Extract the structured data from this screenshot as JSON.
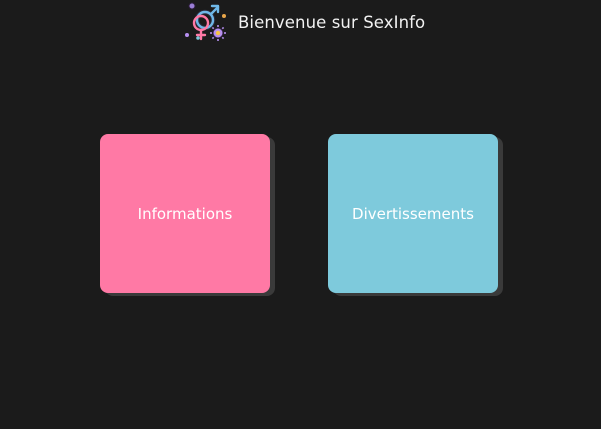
{
  "header": {
    "logo_icon": "gender-symbols-logo-icon",
    "title": "Bienvenue sur SexInfo"
  },
  "cards": [
    {
      "label": "Informations",
      "color": "#ff79a5"
    },
    {
      "label": "Divertissements",
      "color": "#7ecadc"
    }
  ],
  "colors": {
    "background": "#1b1b1b",
    "card_shadow": "#3a3a3a"
  }
}
